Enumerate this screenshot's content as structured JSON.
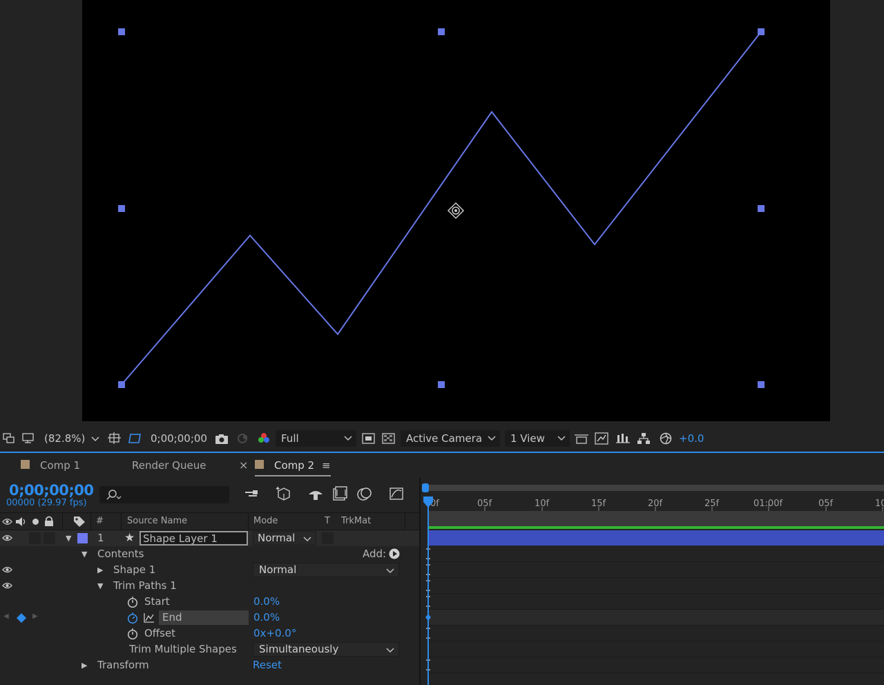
{
  "viewer": {
    "zoom": "(82.8%)",
    "timecode": "0;00;00;00",
    "resolution": "Full",
    "camera": "Active Camera",
    "views": "1 View",
    "exposure": "+0.0",
    "shape_color": "#6777e6"
  },
  "tabs": [
    {
      "label": "Comp 1",
      "close": ""
    },
    {
      "label": "Render Queue",
      "close": "×"
    },
    {
      "label": "Comp 2",
      "menu": "≡"
    }
  ],
  "timeline": {
    "current_time": "0;00;00;00",
    "frame_info": "00000 (29.97 fps)",
    "columns": {
      "number": "#",
      "source_name": "Source Name",
      "mode": "Mode",
      "t": "T",
      "trkmat": "TrkMat"
    },
    "layer": {
      "number": "1",
      "name": "Shape Layer 1",
      "mode": "Normal",
      "label_color": "#6f7af0"
    },
    "properties": {
      "contents": "Contents",
      "add": "Add:",
      "shape": "Shape 1",
      "shape_mode": "Normal",
      "trim_paths": "Trim Paths 1",
      "start_label": "Start",
      "start_value": "0.0%",
      "end_label": "End",
      "end_value": "0.0%",
      "offset_label": "Offset",
      "offset_value": "0x+0.0°",
      "trim_multiple_label": "Trim Multiple Shapes",
      "trim_multiple_value": "Simultaneously",
      "transform": "Transform",
      "transform_reset": "Reset"
    },
    "ruler_ticks": [
      "0f",
      "05f",
      "10f",
      "15f",
      "20f",
      "25f",
      "01:00f",
      "05f",
      "10"
    ],
    "colors": {
      "accent": "#2d8ceb",
      "layer_bar": "#3d4fbe",
      "work_area": "#34b233"
    }
  }
}
